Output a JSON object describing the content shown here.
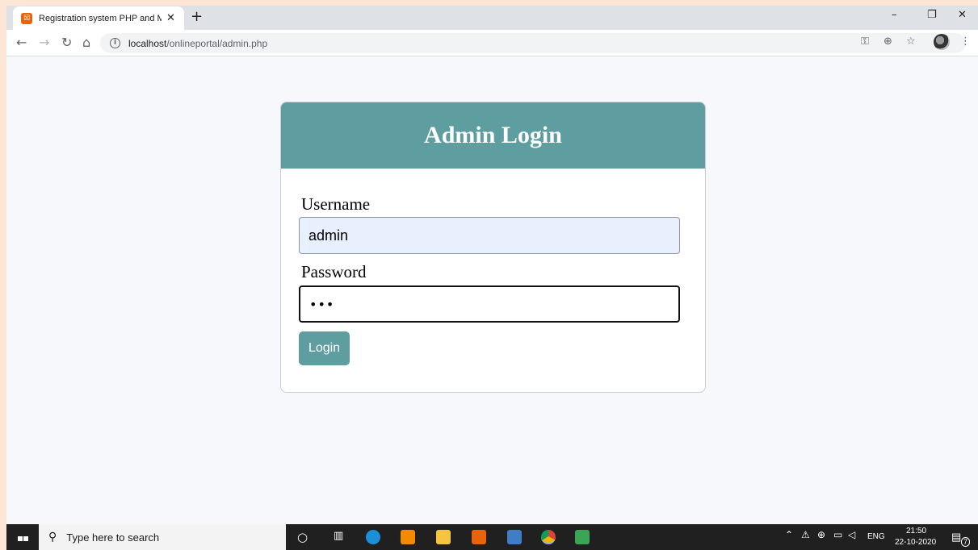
{
  "browser": {
    "tab_title": "Registration system PHP and My",
    "tab_close": "✕",
    "new_tab": "+",
    "url_host": "localhost",
    "url_path": "/onlineportal/admin.php",
    "window_controls": {
      "minimize": "–",
      "restore": "❐",
      "close": "✕"
    },
    "nav": {
      "back": "←",
      "forward": "→",
      "reload": "↻",
      "home": "⌂"
    },
    "toolbar_icons": {
      "key": "⚿",
      "zoom": "⊕",
      "star": "☆",
      "menu": "⋮"
    }
  },
  "login": {
    "title": "Admin Login",
    "username_label": "Username",
    "username_value": "admin",
    "password_label": "Password",
    "password_mask": "•••",
    "button_label": "Login"
  },
  "taskbar": {
    "search_placeholder": "Type here to search",
    "language": "ENG",
    "time": "21:50",
    "date": "22-10-2020",
    "notification_count": "7"
  },
  "colors": {
    "accent": "#5f9ea0",
    "page_background": "#f6f8fb",
    "autofill_background": "#e8f0fe"
  }
}
